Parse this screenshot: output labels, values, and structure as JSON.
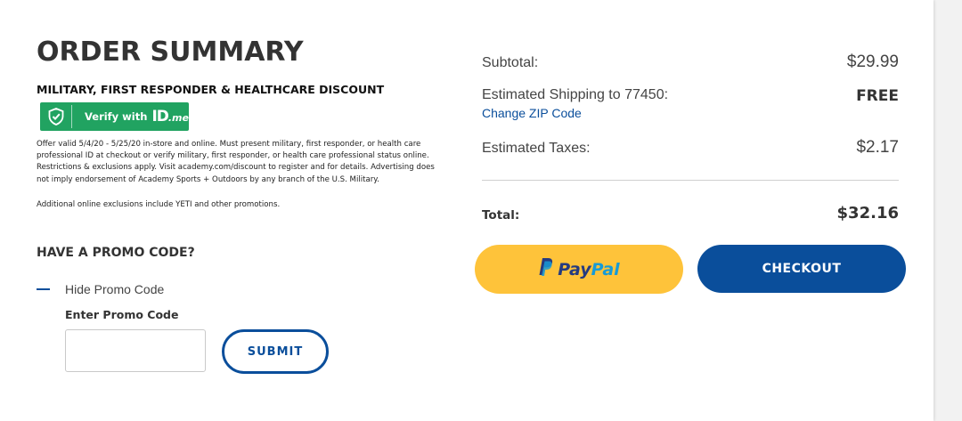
{
  "summary": {
    "title": "ORDER SUMMARY",
    "discount_heading": "MILITARY, FIRST RESPONDER & HEALTHCARE DISCOUNT",
    "idme": {
      "verify_label": "Verify with",
      "logo_text": "ID",
      "logo_suffix": ".me",
      "bg_color": "#21a361",
      "icon": "shield-check-icon"
    },
    "offer_text": "Offer valid 5/4/20 - 5/25/20 in-store and online. Must present military, first responder, or health care professional ID at checkout or verify military, first responder, or health care professional status online. Restrictions & exclusions apply. Visit academy.com/discount to register and for details. Advertising does not imply endorsement of Academy Sports + Outdoors by any branch of the U.S. Military.",
    "exclusions_text": "Additional online exclusions include YETI and other promotions."
  },
  "promo": {
    "heading": "HAVE A PROMO CODE?",
    "toggle_label": "Hide Promo Code",
    "input_label": "Enter Promo Code",
    "input_value": "",
    "submit_label": "SUBMIT"
  },
  "totals": {
    "subtotal_label": "Subtotal:",
    "subtotal_value": "$29.99",
    "shipping_label": "Estimated Shipping to 77450:",
    "change_zip_label": "Change ZIP Code",
    "shipping_value": "FREE",
    "taxes_label": "Estimated Taxes:",
    "taxes_value": "$2.17",
    "total_label": "Total:",
    "total_value": "$32.16"
  },
  "actions": {
    "paypal_pay": "Pay",
    "paypal_pal": "Pal",
    "checkout_label": "CHECKOUT"
  },
  "colors": {
    "brand_blue": "#0a4e9b",
    "paypal_yellow": "#fec33a",
    "idme_green": "#21a361"
  }
}
